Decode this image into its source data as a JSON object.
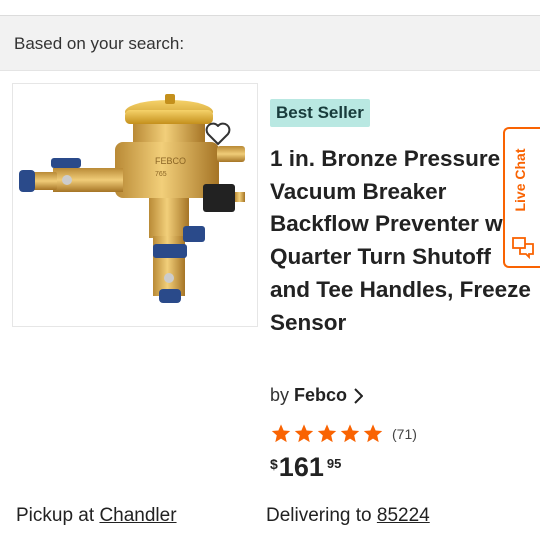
{
  "section": {
    "heading": "Based on your search:"
  },
  "product": {
    "badge": "Best Seller",
    "title": "1 in. Bronze Pressure Vacuum Breaker Backflow Preventer with Quarter Turn Shutoff and Tee Handles, Freeze Sensor",
    "brand_prefix": "by",
    "brand": "Febco",
    "rating_value": 5,
    "review_count": "(71)",
    "price": {
      "currency": "$",
      "dollars": "161",
      "cents": "95"
    },
    "image_icon": "backflow-preventer-valve",
    "favorite_icon": "heart-outline-icon"
  },
  "fulfillment": {
    "pickup_prefix": "Pickup at",
    "pickup_store": "Chandler",
    "delivery_prefix": "Delivering to",
    "delivery_zip": "85224"
  },
  "live_chat": {
    "label": "Live Chat",
    "icon": "chat-bubbles-icon"
  },
  "colors": {
    "accent": "#f96302",
    "badge_bg": "#b9e8e2",
    "star": "#f96302"
  }
}
